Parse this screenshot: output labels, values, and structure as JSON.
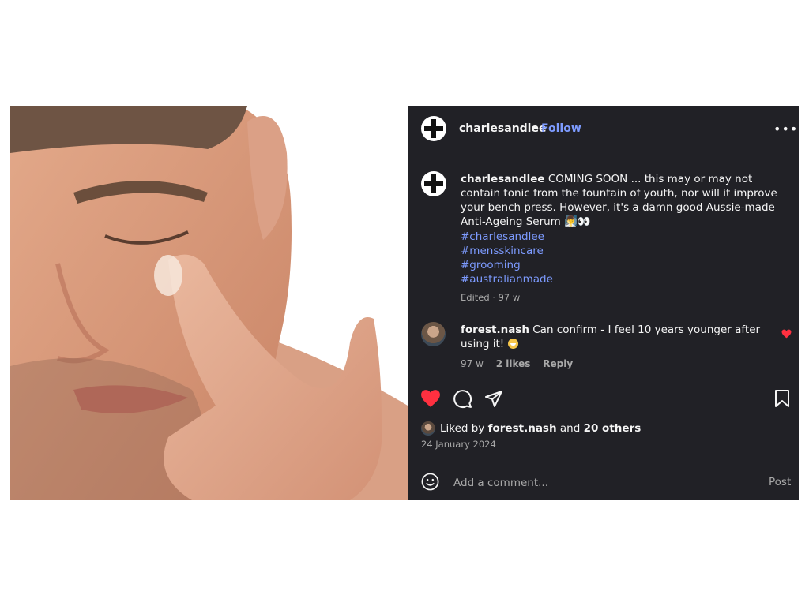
{
  "post": {
    "username": "charlesandlee",
    "separator": "•",
    "follow_label": "Follow",
    "more_label": "•••",
    "caption_username": "charlesandlee",
    "caption_text": " COMING SOON ... this may or may not contain tonic from the fountain of youth, nor will it improve your bench press. However, it's a damn good Aussie-made Anti-Ageing Serum 🧖‍♂️👀",
    "hashtags": [
      "#charlesandlee",
      "#mensskincare",
      "#grooming",
      "#australianmade"
    ],
    "edited": "Edited · 97 w"
  },
  "comment": {
    "username": "forest.nash",
    "text": " Can confirm - I feel 10 years younger after using it! ",
    "time": "97 w",
    "likes": "2 likes",
    "reply_label": "Reply"
  },
  "actions": {
    "liked": true,
    "icons": [
      "heart-icon",
      "comment-icon",
      "share-icon",
      "bookmark-icon"
    ]
  },
  "likes": {
    "prefix": "Liked by ",
    "user": "forest.nash",
    "middle": " and ",
    "others": "20 others",
    "date": "24 January 2024"
  },
  "compose": {
    "placeholder": "Add a comment...",
    "post_label": "Post"
  },
  "colors": {
    "panel_bg": "#212126",
    "link": "#7d9bff",
    "heart": "#ff3040",
    "muted": "#a8a8a8"
  }
}
